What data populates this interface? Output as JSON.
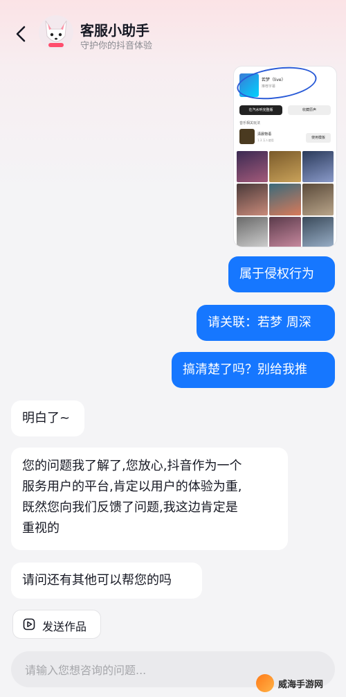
{
  "header": {
    "title": "客服小助手",
    "subtitle": "守护你的抖音体验"
  },
  "shared_screenshot": {
    "song_title": "若梦（live）",
    "song_sub": "推荐字幕",
    "btn_primary": "在汽水听完整版",
    "btn_secondary": "收藏原声",
    "section": "音乐相关玩法",
    "template_name": "清晨物语",
    "template_count": "1.3 万人使用",
    "use_template": "使用模板"
  },
  "messages": [
    {
      "from": "me",
      "text": "属于侵权行为"
    },
    {
      "from": "me",
      "text": "请关联：若梦 周深"
    },
    {
      "from": "me",
      "text": "搞清楚了吗？别给我推"
    },
    {
      "from": "bot",
      "text": "明白了~"
    },
    {
      "from": "bot",
      "lines": [
        "您的问题我了解了,您放心,抖音作为一个",
        "服务用户的平台,肯定以用户的体验为重,",
        "既然您向我们反馈了问题,我这边肯定是",
        "重视的"
      ]
    },
    {
      "from": "bot",
      "text": "请问还有其他可以帮您的吗"
    }
  ],
  "footer": {
    "send_work": "发送作品",
    "input_placeholder": "请输入您想咨询的问题..."
  },
  "watermark": "威海手游网",
  "colors": {
    "accent": "#1677ff",
    "bubble_bot": "#ffffff",
    "bg": "#f4f4f6"
  }
}
